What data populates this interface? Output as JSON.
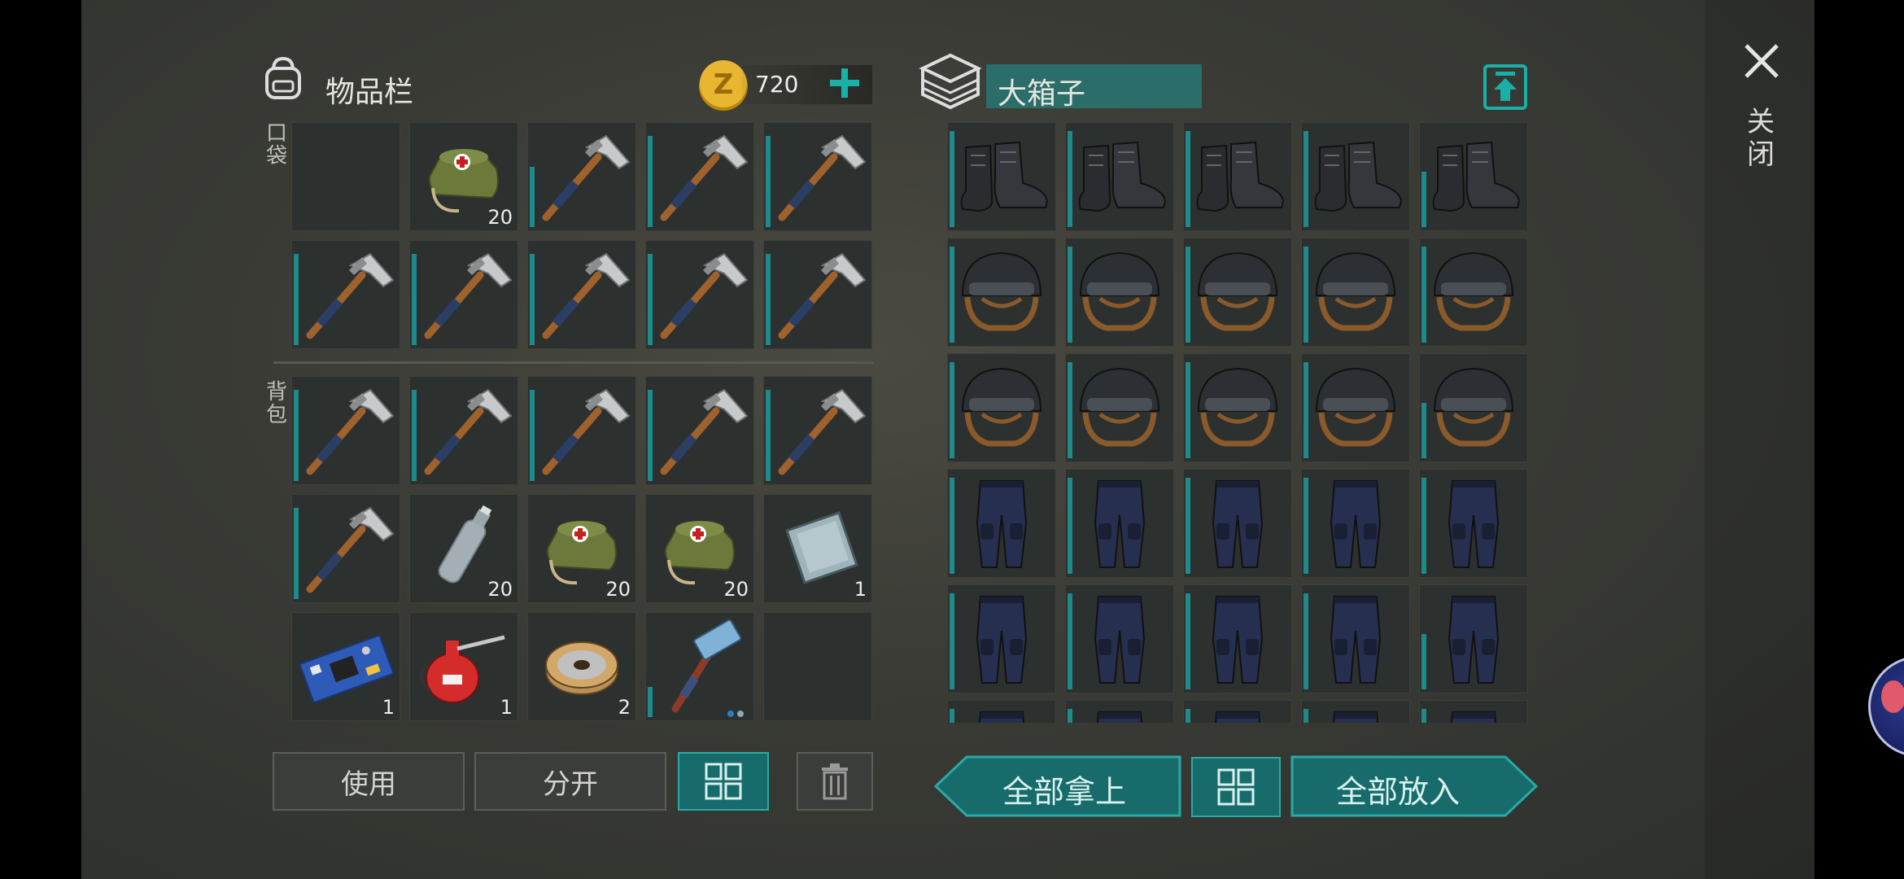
{
  "inventory": {
    "title": "物品栏",
    "coins": "720",
    "pocket_label": "口袋",
    "backpack_label": "背包",
    "pocket_slots": [
      {
        "icon": "empty",
        "count": "",
        "dur": null
      },
      {
        "icon": "medkit-bag",
        "count": "20",
        "dur": null
      },
      {
        "icon": "pickaxe",
        "count": "",
        "dur": 0.6
      },
      {
        "icon": "pickaxe",
        "count": "",
        "dur": 0.9
      },
      {
        "icon": "pickaxe",
        "count": "",
        "dur": 0.9
      },
      {
        "icon": "pickaxe",
        "count": "",
        "dur": 0.9
      },
      {
        "icon": "pickaxe",
        "count": "",
        "dur": 0.9
      },
      {
        "icon": "pickaxe",
        "count": "",
        "dur": 0.9
      },
      {
        "icon": "pickaxe",
        "count": "",
        "dur": 0.9
      },
      {
        "icon": "pickaxe",
        "count": "",
        "dur": 0.9
      }
    ],
    "backpack_slots": [
      {
        "icon": "pickaxe",
        "count": "",
        "dur": 0.9
      },
      {
        "icon": "pickaxe",
        "count": "",
        "dur": 0.9
      },
      {
        "icon": "pickaxe",
        "count": "",
        "dur": 0.9
      },
      {
        "icon": "pickaxe",
        "count": "",
        "dur": 0.9
      },
      {
        "icon": "pickaxe",
        "count": "",
        "dur": 0.9
      },
      {
        "icon": "pickaxe",
        "count": "",
        "dur": 0.9
      },
      {
        "icon": "water-bottle",
        "count": "20",
        "dur": null
      },
      {
        "icon": "medkit-bag",
        "count": "20",
        "dur": null
      },
      {
        "icon": "medkit-bag",
        "count": "20",
        "dur": null
      },
      {
        "icon": "metal-plate",
        "count": "1",
        "dur": null
      },
      {
        "icon": "circuit-board",
        "count": "1",
        "dur": null
      },
      {
        "icon": "oil-can",
        "count": "1",
        "dur": null
      },
      {
        "icon": "wire-spool",
        "count": "2",
        "dur": null
      },
      {
        "icon": "sledgehammer",
        "count": "",
        "dur": 0.3
      },
      {
        "icon": "empty",
        "count": "",
        "dur": null
      }
    ],
    "buttons": {
      "use": "使用",
      "split": "分开"
    }
  },
  "container": {
    "title": "大箱子",
    "rows": [
      [
        "boots",
        "boots",
        "boots",
        "boots",
        "boots"
      ],
      [
        "helmet",
        "helmet",
        "helmet",
        "helmet",
        "helmet"
      ],
      [
        "helmet",
        "helmet",
        "helmet",
        "helmet",
        "helmet"
      ],
      [
        "pants",
        "pants",
        "pants",
        "pants",
        "pants"
      ],
      [
        "pants",
        "pants",
        "pants",
        "pants",
        "pants"
      ],
      [
        "pants",
        "pants",
        "pants",
        "pants",
        "pants"
      ]
    ],
    "buttons": {
      "take_all": "全部拿上",
      "put_all": "全部放入"
    }
  },
  "close_label": "关闭",
  "colors": {
    "accent": "#1f8a8a",
    "teal_button": "#176b6b",
    "slot_bg": "#2c302f"
  }
}
